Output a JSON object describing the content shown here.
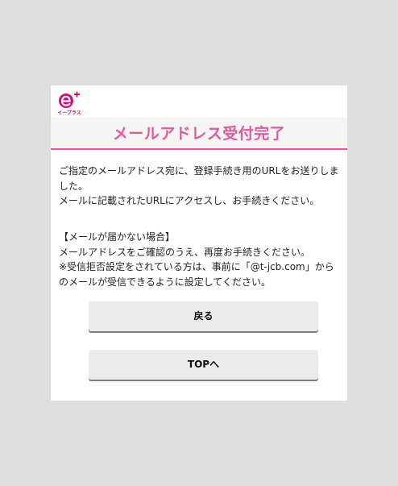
{
  "logo": {
    "text": "イープラス",
    "icon": "eplus-logo",
    "brand_color": "#e5007f"
  },
  "page": {
    "title": "メールアドレス受付完了",
    "title_color": "#e9569c"
  },
  "message": {
    "line1": "ご指定のメールアドレス宛に、登録手続き用のURLをお送りしました。",
    "line2": "メールに記載されたURLにアクセスし、お手続きください。"
  },
  "notice": {
    "heading": "【メールが届かない場合】",
    "line1": "メールアドレスをご確認のうえ、再度お手続きください。",
    "line2": "※受信拒否設定をされている方は、事前に「@t-jcb.com」からのメールが受信できるように設定してください。"
  },
  "buttons": {
    "back": "戻る",
    "top": "TOPへ"
  }
}
